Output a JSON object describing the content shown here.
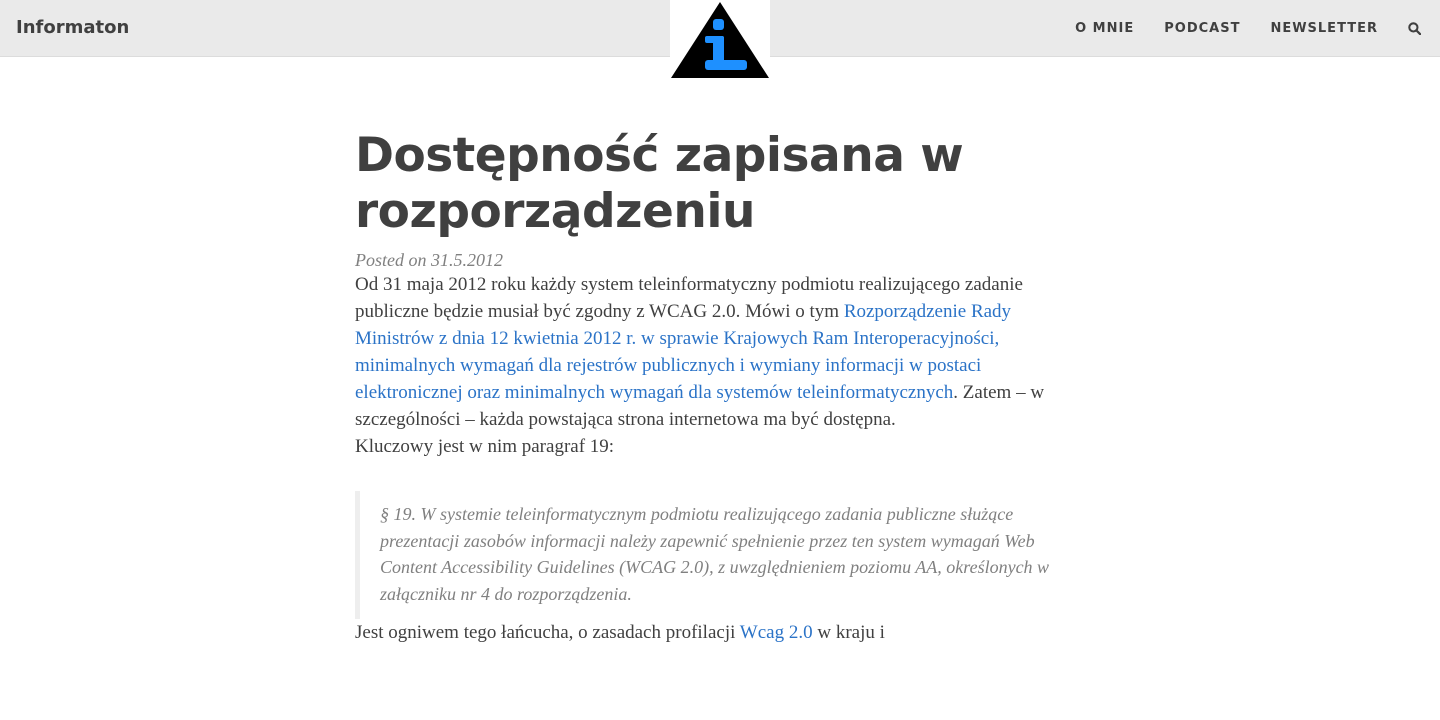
{
  "navbar": {
    "brand": "Informaton",
    "logo_letter": "i",
    "links": [
      "O MNIE",
      "PODCAST",
      "NEWSLETTER"
    ],
    "search_icon": "search-icon"
  },
  "post": {
    "title_line1": "Dostępność zapisana w",
    "title_line2": "rozporządzeniu",
    "meta": "Posted on 31.5.2012",
    "p1_text_a": "Od 31 maja 2012 roku każdy system teleinformatyczny podmiotu realizującego zadanie publiczne będzie musiał być zgodny z WCAG 2.0. Mówi o tym ",
    "p1_link": "Rozporządzenie Rady Ministrów z dnia 12 kwietnia 2012 r. w sprawie Krajowych Ram Interoperacyjności, minimalnych wymagań dla rejestrów publicznych i wymiany informacji w postaci elektronicznej oraz minimalnych wymagań dla systemów teleinformatycznych",
    "p1_text_b": ". Zatem – w szczególności – każda powstająca strona internetowa ma być dostępna.",
    "p2": "Kluczowy jest w nim paragraf 19:",
    "quote": "§ 19. W systemie teleinformatycznym podmiotu realizującego zadania publiczne służące prezentacji zasobów informacji należy zapewnić spełnienie przez ten system wymagań Web Content Accessibility Guidelines (WCAG 2.0), z uwzględnieniem poziomu AA, określonych w załączniku nr 4 do rozporządzenia.",
    "p3_text_a": "Jest ogniwem tego łańcucha, o zasadach profilacji ",
    "p3_link": "Wcag 2.0",
    "p3_text_b": " w kraju i"
  },
  "colors": {
    "navbar_bg": "#eaeaea",
    "text": "#404040",
    "link": "#2b73c7",
    "logo_triangle": "#000000",
    "logo_i": "#1e90ff"
  }
}
